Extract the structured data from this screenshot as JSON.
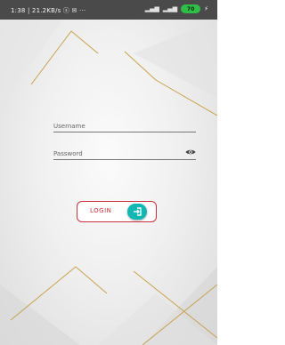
{
  "status_bar": {
    "left_text": "1:38 | 21.2KB/s ⓢ ✉ ···",
    "battery": "70"
  },
  "form": {
    "username_label": "Username",
    "password_label": "Password"
  },
  "login_button": {
    "label": "LOGIN"
  },
  "icons": {
    "password_visibility": "eye-icon",
    "login": "login-arrow-icon",
    "signal": "signal-icon",
    "battery": "battery-icon",
    "charging": "bolt-icon"
  },
  "colors": {
    "statusbar": "#4a4a4a",
    "gold_lines": "#c8a24c",
    "login_border": "#c9313c",
    "login_icon_bg": "#10b7b3",
    "battery": "#2fbf48"
  }
}
